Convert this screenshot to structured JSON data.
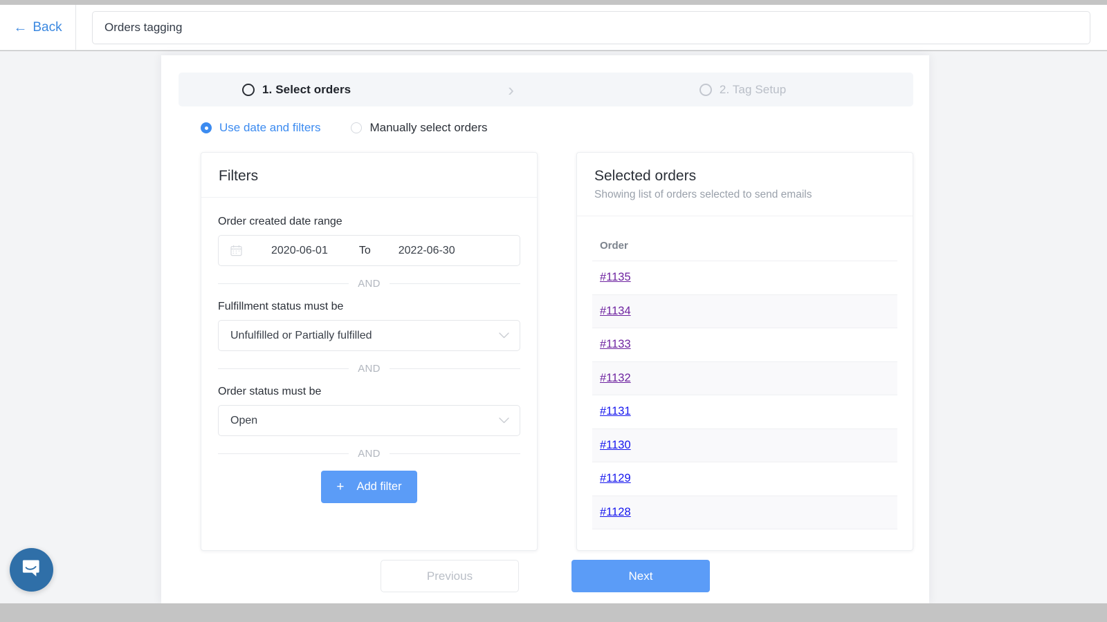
{
  "topbar": {
    "back_label": "Back",
    "back_icon": "arrow-left-icon",
    "title_value": "Orders tagging",
    "title_placeholder": "Orders tagging"
  },
  "stepper": {
    "steps": [
      {
        "label": "1. Select orders",
        "state": "active"
      },
      {
        "label": "2. Tag Setup",
        "state": "inactive"
      }
    ],
    "separator": "›"
  },
  "mode_selector": {
    "options": [
      {
        "label": "Use date and filters",
        "selected": true
      },
      {
        "label": "Manually select orders",
        "selected": false
      }
    ]
  },
  "filters_panel": {
    "title": "Filters",
    "date_filter": {
      "label": "Order created date range",
      "icon": "calendar-icon",
      "start": "2020-06-01",
      "separator": "To",
      "end": "2022-06-30"
    },
    "and_label": "AND",
    "fulfillment_filter": {
      "label": "Fulfillment status must be",
      "value": "Unfulfilled or Partially fulfilled"
    },
    "order_status_filter": {
      "label": "Order status must be",
      "value": "Open"
    },
    "add_filter": {
      "label": "Add filter",
      "icon": "plus-icon",
      "color": "#5b9cf7"
    }
  },
  "orders_panel": {
    "title": "Selected orders",
    "subtitle": "Showing list of orders selected to send emails",
    "column_header": "Order",
    "rows": [
      {
        "order": "#1135",
        "link_state": "visited"
      },
      {
        "order": "#1134",
        "link_state": "visited"
      },
      {
        "order": "#1133",
        "link_state": "visited"
      },
      {
        "order": "#1132",
        "link_state": "visited"
      },
      {
        "order": "#1131",
        "link_state": "fresh"
      },
      {
        "order": "#1130",
        "link_state": "fresh"
      },
      {
        "order": "#1129",
        "link_state": "fresh"
      },
      {
        "order": "#1128",
        "link_state": "fresh"
      }
    ]
  },
  "footer": {
    "previous_label": "Previous",
    "next_label": "Next",
    "next_color": "#5b9cf7"
  },
  "intercom": {
    "icon": "chat-bubble-icon",
    "color": "#2f6fa8"
  }
}
